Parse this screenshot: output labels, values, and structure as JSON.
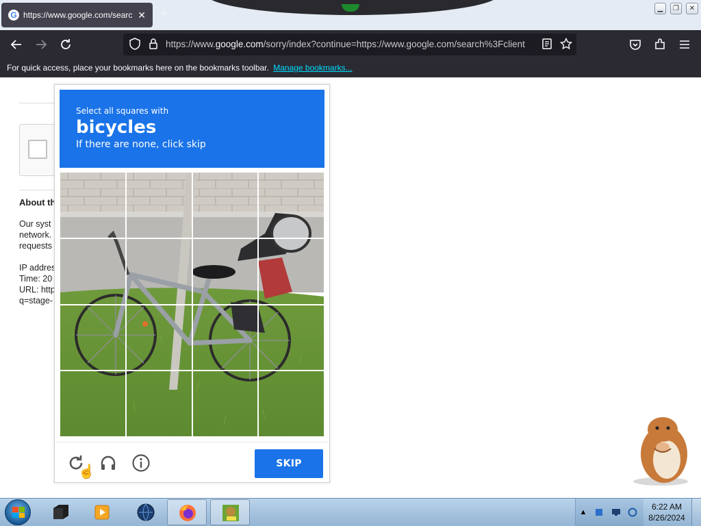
{
  "browser": {
    "tab": {
      "title": "https://www.google.com/search",
      "close_glyph": "✕",
      "favicon": "G",
      "new_tab_glyph": "+"
    },
    "url": {
      "prefix": "https://www.",
      "domain": "google.com",
      "rest": "/sorry/index?continue=https://www.google.com/search%3Fclient"
    },
    "bookmarks_bar": {
      "message": "For quick access, place your bookmarks here on the bookmarks toolbar.",
      "link": "Manage bookmarks..."
    }
  },
  "sorry_page": {
    "heading": "About th",
    "lines": [
      "Our syst",
      "network.",
      "requests"
    ],
    "details": [
      "IP addres",
      "Time: 20",
      "URL: http",
      "q=stage-"
    ]
  },
  "captcha": {
    "instruction": "Select all squares with",
    "object": "bicycles",
    "hint": "If there are none, click skip",
    "skip_label": "SKIP",
    "grid": {
      "rows": 4,
      "cols": 4
    },
    "icons": {
      "reload": "reload-icon",
      "audio": "headphones-icon",
      "info": "info-icon"
    },
    "accent_color": "#1a73e8"
  },
  "taskbar": {
    "apps": [
      "terminal",
      "media-player",
      "browser-globe",
      "firefox",
      "game-box"
    ],
    "clock": {
      "time": "6:22 AM",
      "date": "8/26/2024"
    },
    "tray_expand": "▲"
  }
}
